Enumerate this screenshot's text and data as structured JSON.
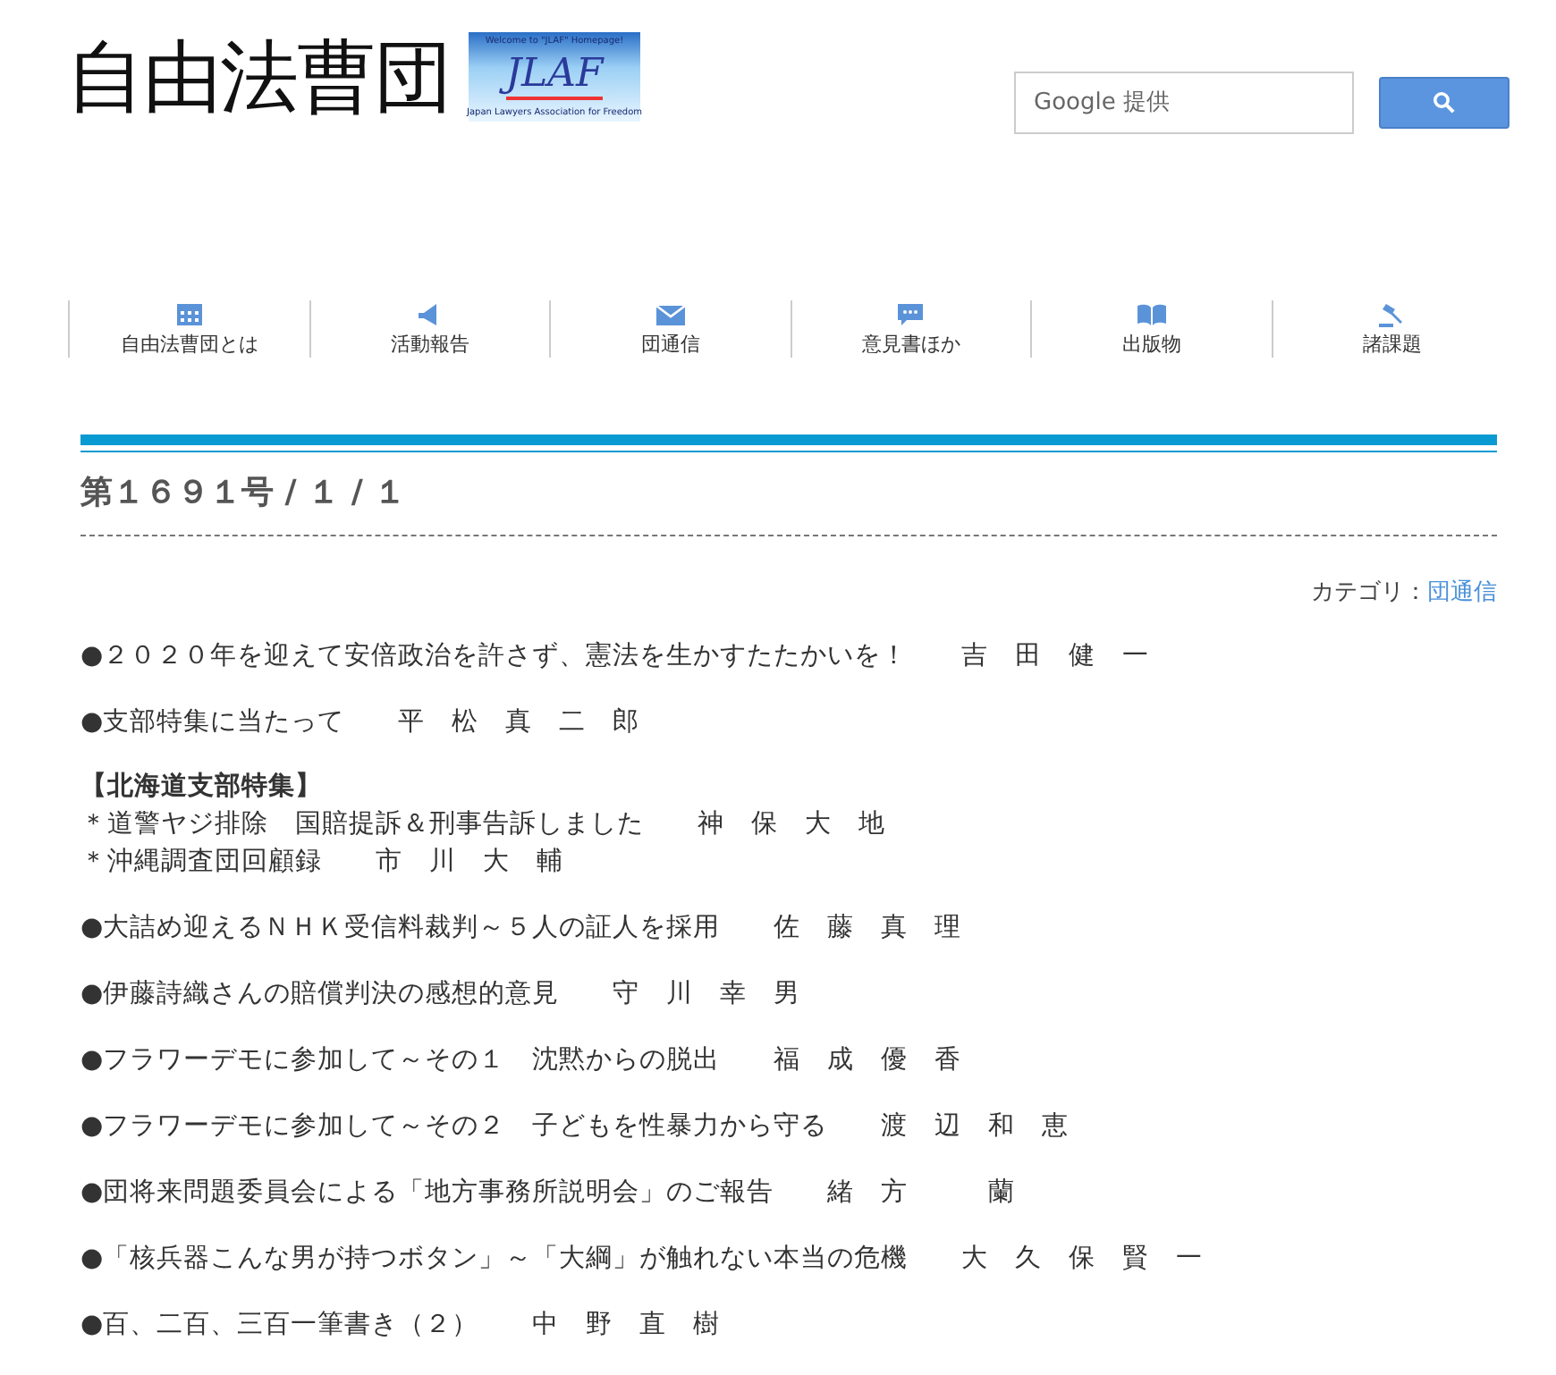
{
  "header": {
    "logo_text": "自由法曹団",
    "badge": {
      "welcome": "Welcome to \"JLAF\" Homepage!",
      "title": "JLAF",
      "subtitle": "Japan Lawyers Association for Freedom"
    },
    "search": {
      "placeholder": "Google 提供"
    }
  },
  "nav": [
    {
      "label": "自由法曹団とは"
    },
    {
      "label": "活動報告"
    },
    {
      "label": "団通信"
    },
    {
      "label": "意見書ほか"
    },
    {
      "label": "出版物"
    },
    {
      "label": "諸課題"
    }
  ],
  "page_title": "第１６９１号 / １ / １",
  "category": {
    "label": "カテゴリ：",
    "link": "団通信"
  },
  "articles": [
    {
      "kind": "item",
      "title": "●２０２０年を迎えて安倍政治を許さず、憲法を生かすたたかいを！",
      "author": "吉　田　健　一"
    },
    {
      "kind": "item",
      "title": "●支部特集に当たって",
      "author": "平　松　真　二　郎"
    },
    {
      "kind": "section",
      "heading": "【北海道支部特集】",
      "lines": [
        {
          "title": "＊道警ヤジ排除　国賠提訴＆刑事告訴しました",
          "author": "神　保　大　地"
        },
        {
          "title": "＊沖縄調査団回顧録",
          "author": "市　川　大　輔"
        }
      ]
    },
    {
      "kind": "item",
      "title": "●大詰め迎えるＮＨＫ受信料裁判～５人の証人を採用",
      "author": "佐　藤　真　理"
    },
    {
      "kind": "item",
      "title": "●伊藤詩織さんの賠償判決の感想的意見",
      "author": "守　川　幸　男"
    },
    {
      "kind": "item",
      "title": "●フラワーデモに参加して～その１　沈黙からの脱出",
      "author": "福　成　優　香"
    },
    {
      "kind": "item",
      "title": "●フラワーデモに参加して～その２　子どもを性暴力から守る",
      "author": "渡　辺　和　恵"
    },
    {
      "kind": "item",
      "title": "●団将来問題委員会による「地方事務所説明会」のご報告",
      "author": "緒　方　　　蘭"
    },
    {
      "kind": "item",
      "title": "●「核兵器こんな男が持つボタン」～「大綱」が触れない本当の危機",
      "author": "大　久　保　賢　一"
    },
    {
      "kind": "item",
      "title": "●百、二百、三百一筆書き（２）",
      "author": "中　野　直　樹"
    }
  ]
}
